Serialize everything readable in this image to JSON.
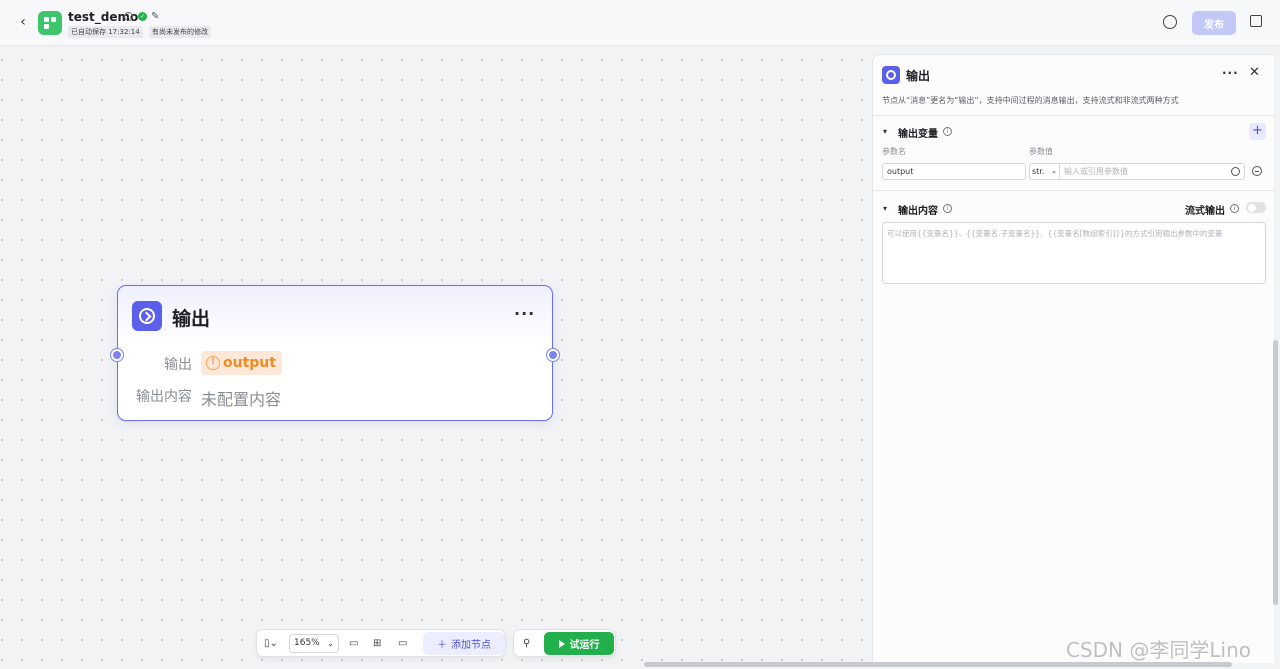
{
  "header": {
    "title": "test_demo",
    "autosave": "已自动保存 17:32:14",
    "unpublished": "有尚未发布的修改",
    "publish_label": "发布"
  },
  "node": {
    "title": "输出",
    "output_label": "输出",
    "output_var": "output",
    "content_label": "输出内容",
    "content_value": "未配置内容"
  },
  "toolbar": {
    "zoom": "165%",
    "add_node_label": "添加节点",
    "run_label": "试运行"
  },
  "panel": {
    "title": "输出",
    "description": "节点从“消息”更名为“输出”，支持中间过程的消息输出，支持流式和非流式两种方式",
    "vars_section": "输出变量",
    "col_name": "参数名",
    "col_value": "参数值",
    "var_name": "output",
    "var_type": "str.",
    "var_value_placeholder": "输入或引用参数值",
    "content_section": "输出内容",
    "stream_label": "流式输出",
    "content_placeholder": "可以使用{{变量名}}、{{变量名.子变量名}}、{{变量名[数组索引]}}的方式引用输出参数中的变量"
  },
  "watermark": "CSDN @李同学Lino"
}
